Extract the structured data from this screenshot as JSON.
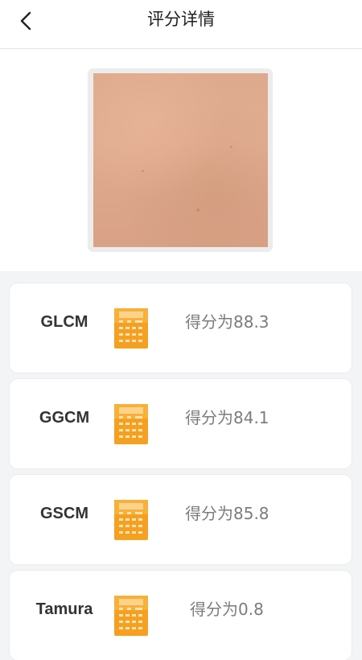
{
  "header": {
    "title": "评分详情",
    "back_icon": "chevron-left-icon"
  },
  "scores": [
    {
      "name": "GLCM",
      "score_text": "得分为88.3",
      "icon": "calculator-icon"
    },
    {
      "name": "GGCM",
      "score_text": "得分为84.1",
      "icon": "calculator-icon"
    },
    {
      "name": "GSCM",
      "score_text": "得分为85.8",
      "icon": "calculator-icon"
    },
    {
      "name": "Tamura",
      "score_text": "得分为0.8",
      "icon": "calculator-icon"
    }
  ],
  "colors": {
    "icon_orange": "#f5a021",
    "background": "#f3f4f6",
    "score_text": "#7c7c7c"
  }
}
